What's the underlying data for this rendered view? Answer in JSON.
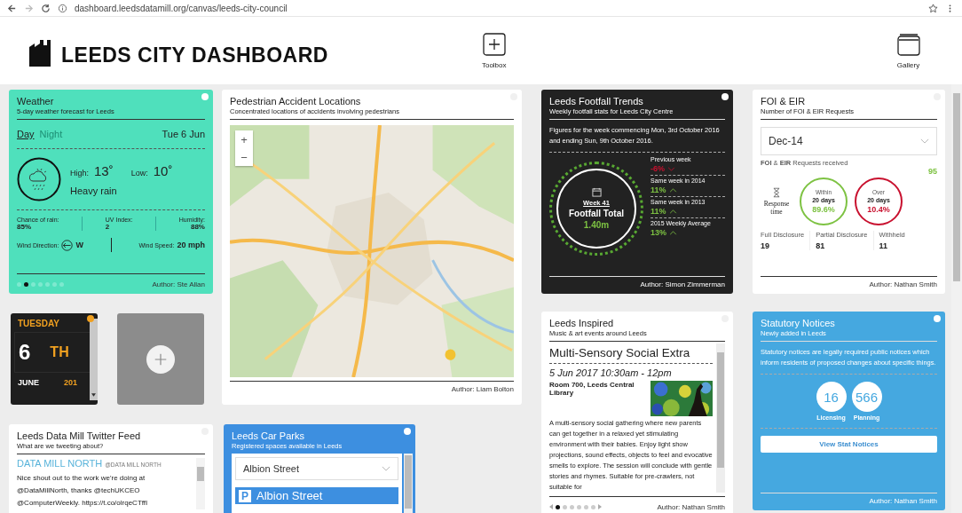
{
  "browser": {
    "url": "dashboard.leedsdatamill.org/canvas/leeds-city-council"
  },
  "header": {
    "title": "LEEDS CITY DASHBOARD",
    "actions": [
      {
        "kind": "toolbox",
        "label": "Toolbox"
      },
      {
        "kind": "gallery",
        "label": "Gallery"
      }
    ]
  },
  "weather": {
    "title": "Weather",
    "subtitle": "5-day weather forecast for Leeds",
    "tabs": [
      {
        "label": "Day",
        "selected": true
      },
      {
        "label": "Night",
        "selected": false
      }
    ],
    "date": "Tue 6 Jun",
    "high_label": "High:",
    "high": "13˚",
    "low_label": "Low:",
    "low": "10˚",
    "condition": "Heavy rain",
    "stats": [
      {
        "label": "Chance of rain:",
        "value": "85%"
      },
      {
        "label": "UV Index:",
        "value": "2"
      },
      {
        "label": "Humidity:",
        "value": "88%"
      }
    ],
    "wind_direction_label": "Wind Direction:",
    "wind_direction": "W",
    "wind_speed_label": "Wind Speed:",
    "wind_speed": "20 mph",
    "pages": [
      {
        "selected": false
      },
      {
        "selected": true
      },
      {
        "selected": false
      },
      {
        "selected": false
      },
      {
        "selected": false
      },
      {
        "selected": false
      },
      {
        "selected": false
      }
    ],
    "author": "Author: Ste Allan"
  },
  "calendar": {
    "weekday": "TUESDAY",
    "day": "6",
    "suffix": "TH",
    "month": "JUNE",
    "year": "201"
  },
  "twitter": {
    "title": "Leeds Data Mill Twitter Feed",
    "subtitle": "What are we tweeting about?",
    "tweets": [
      {
        "name": "DATA MILL NORTH",
        "handle": "@DATA MILL NORTH",
        "text": "Nice shout out to the work we're doing at @DataMillNorth, thanks @techUKCEO @ComputerWeekly. https://t.co/olrqeCTffI"
      }
    ]
  },
  "accidents": {
    "title": "Pedestrian Accident Locations",
    "subtitle": "Concentrated locations of accidents involving pedestrians",
    "zoom": [
      "+",
      "−"
    ],
    "author": "Author: Liam Bolton"
  },
  "car_parks": {
    "title": "Leeds Car Parks",
    "subtitle": "Registered spaces available in Leeds",
    "selected_car_park": "Albion Street",
    "sign": "P",
    "heading": "Albion Street"
  },
  "footfall": {
    "title": "Leeds Footfall Trends",
    "subtitle": "Weekly footfall stats for Leeds City Centre",
    "intro": "Figures for the week commencing Mon, 3rd October 2016 and ending Sun, 9th October 2016.",
    "week": "Week 41",
    "total_label": "Footfall Total",
    "total": "1.40m",
    "comparisons": [
      {
        "label": "Previous week",
        "value": "-6%",
        "rising": false
      },
      {
        "label": "Same week in 2014",
        "value": "11%",
        "rising": true
      },
      {
        "label": "Same week in 2013",
        "value": "11%",
        "rising": true
      },
      {
        "label": "2015 Weekly Average",
        "value": "13%",
        "rising": true
      }
    ],
    "author": "Author: Simon Zimmerman"
  },
  "inspired": {
    "title": "Leeds Inspired",
    "subtitle": "Music & art events around Leeds",
    "event_title": "Multi-Sensory Social Extra",
    "when": "5 Jun 2017 10:30am - 12pm",
    "venue": "Room 700, Leeds Central Library",
    "description": "A multi-sensory social gathering where new parents can get together in a relaxed yet stimulating environment with their babies. Enjoy light show projections, sound effects, objects to feel and evocative smells to explore. The session will conclude with gentle stories and rhymes.  Suitable for pre-crawlers, not suitable for",
    "pages": [
      {
        "selected": true
      },
      {
        "selected": false
      },
      {
        "selected": false
      },
      {
        "selected": false
      },
      {
        "selected": false
      },
      {
        "selected": false
      }
    ],
    "author": "Author: Nathan Smith"
  },
  "foi": {
    "title": "FOI & EIR",
    "subtitle": "Number of FOI & EIR Requests",
    "period": "Dec-14",
    "received_label": "**FOI** & **EIR** Requests received",
    "received": "95",
    "response_label": "Response time",
    "rings": [
      {
        "kind": "within",
        "line1": "Within",
        "line2": "20 days",
        "value": "89.6%"
      },
      {
        "kind": "over",
        "line1": "Over",
        "line2": "20 days",
        "value": "10.4%"
      }
    ],
    "disclosures": [
      {
        "label": "Full Disclosure",
        "value": "19"
      },
      {
        "label": "Partial Disclosure",
        "value": "81"
      },
      {
        "label": "Withheld",
        "value": "11"
      }
    ],
    "author": "Author: Nathan Smith"
  },
  "notices": {
    "title": "Statutory Notices",
    "subtitle": "Newly added in Leeds",
    "description": "Statutory notices are legally required public notices which inform residents of proposed changes about specific things.",
    "counts": [
      {
        "value": "16",
        "label": "Licensing"
      },
      {
        "value": "566",
        "label": "Planning"
      }
    ],
    "button": "View Stat Notices",
    "author": "Author: Nathan Smith"
  }
}
